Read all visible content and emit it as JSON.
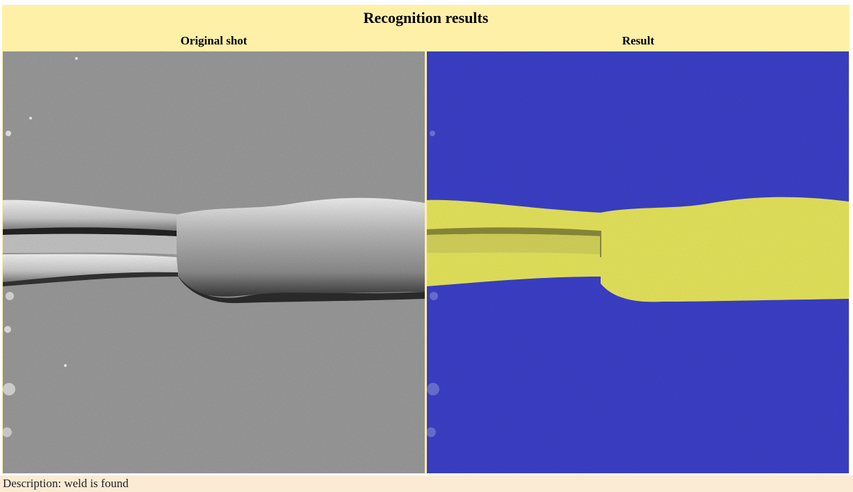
{
  "title": "Recognition results",
  "columns": {
    "original_label": "Original shot",
    "result_label": "Result"
  },
  "description": "Description: weld is found",
  "colors": {
    "header_bg": "#fff0a8",
    "footer_bg": "#fbebd5",
    "background_class": "#3a3fc2",
    "weld_class": "#e3e35a",
    "original_gray": "#8a8a8a"
  }
}
